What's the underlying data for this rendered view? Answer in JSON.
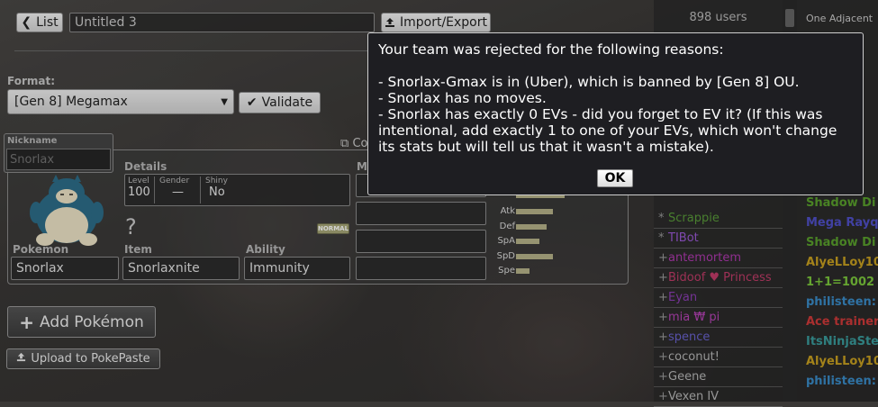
{
  "toolbar": {
    "list_button": "List",
    "team_name": "Untitled 3",
    "import_export": "Import/Export"
  },
  "format": {
    "label": "Format:",
    "selected": "[Gen 8] Megamax",
    "validate_button": "Validate"
  },
  "set": {
    "nickname_label": "Nickname",
    "nickname_placeholder": "Snorlax",
    "copy_label": "Co",
    "details_label": "Details",
    "moves_label": "M",
    "level_label": "Level",
    "level_value": "100",
    "gender_label": "Gender",
    "gender_value": "—",
    "shiny_label": "Shiny",
    "shiny_value": "No",
    "item_unknown": "?",
    "type_badge": "NORMAL",
    "pokemon_label": "Pokemon",
    "pokemon_value": "Snorlax",
    "item_label": "Item",
    "item_value": "Snorlaxnite",
    "ability_label": "Ability",
    "ability_value": "Immunity",
    "stats": [
      {
        "label": "Atk",
        "fraction": 0.55
      },
      {
        "label": "Def",
        "fraction": 0.45
      },
      {
        "label": "SpA",
        "fraction": 0.35
      },
      {
        "label": "SpD",
        "fraction": 0.55
      },
      {
        "label": "Spe",
        "fraction": 0.2
      }
    ]
  },
  "actions": {
    "add_pokemon": "Add Pokémon",
    "upload": "Upload to PokePaste"
  },
  "userlist": {
    "count": "898 users",
    "users": [
      {
        "rank": "*",
        "name": "Scrappie",
        "color": "#5a9c3a"
      },
      {
        "rank": "*",
        "name": "TIBot",
        "color": "#9b59d6"
      },
      {
        "rank": "+",
        "name": "antemortem",
        "color": "#b03ab0"
      },
      {
        "rank": "+",
        "name": "Bidoof ♥ Princess",
        "color": "#c23c6a"
      },
      {
        "rank": "+",
        "name": "Eyan",
        "color": "#8e3fb6"
      },
      {
        "rank": "+",
        "name": "mia ₩ pi",
        "color": "#b844b8"
      },
      {
        "rank": "+",
        "name": "spence",
        "color": "#6b63d0"
      },
      {
        "rank": "+",
        "name": "coconut!",
        "color": "#b8b8b8"
      },
      {
        "rank": "+",
        "name": "Geene",
        "color": "#b8b8b8"
      },
      {
        "rank": "+",
        "name": "Vexen IV",
        "color": "#b8b8b8"
      }
    ]
  },
  "chat": {
    "top_lines": [
      "One Adjacent"
    ],
    "lines": [
      {
        "text": "Shadow Di",
        "color": "#5aa02c"
      },
      {
        "text": "Mega Rayq",
        "color": "#5050c8"
      },
      {
        "text": "Shadow Di",
        "color": "#5aa02c"
      },
      {
        "text": "AlyeLLoy10",
        "color": "#c8a020"
      },
      {
        "text": "1+1=1002",
        "color": "#7cc83c"
      },
      {
        "text": "philisteen:",
        "color": "#3a8cc8"
      },
      {
        "text": "Ace trainer",
        "color": "#d03a3a"
      },
      {
        "text": "ItsNinjaSte",
        "color": "#3a9c9c"
      },
      {
        "text": "AlyeLLoy10",
        "color": "#c8a020"
      },
      {
        "text": "philisteen:",
        "color": "#3a8cc8"
      }
    ]
  },
  "dialog": {
    "message": "Your team was rejected for the following reasons:\n\n- Snorlax-Gmax is in (Uber), which is banned by [Gen 8] OU.\n- Snorlax has no moves.\n- Snorlax has exactly 0 EVs - did you forget to EV it? (If this was intentional, add exactly 1 to one of your EVs, which won't change its stats but will tell us that it wasn't a mistake).",
    "ok_button": "OK"
  },
  "colors": {
    "dialog_bg": "#1e1e22",
    "panel_border": "#8a8a8a",
    "stat_bar": "#b8b48a"
  }
}
